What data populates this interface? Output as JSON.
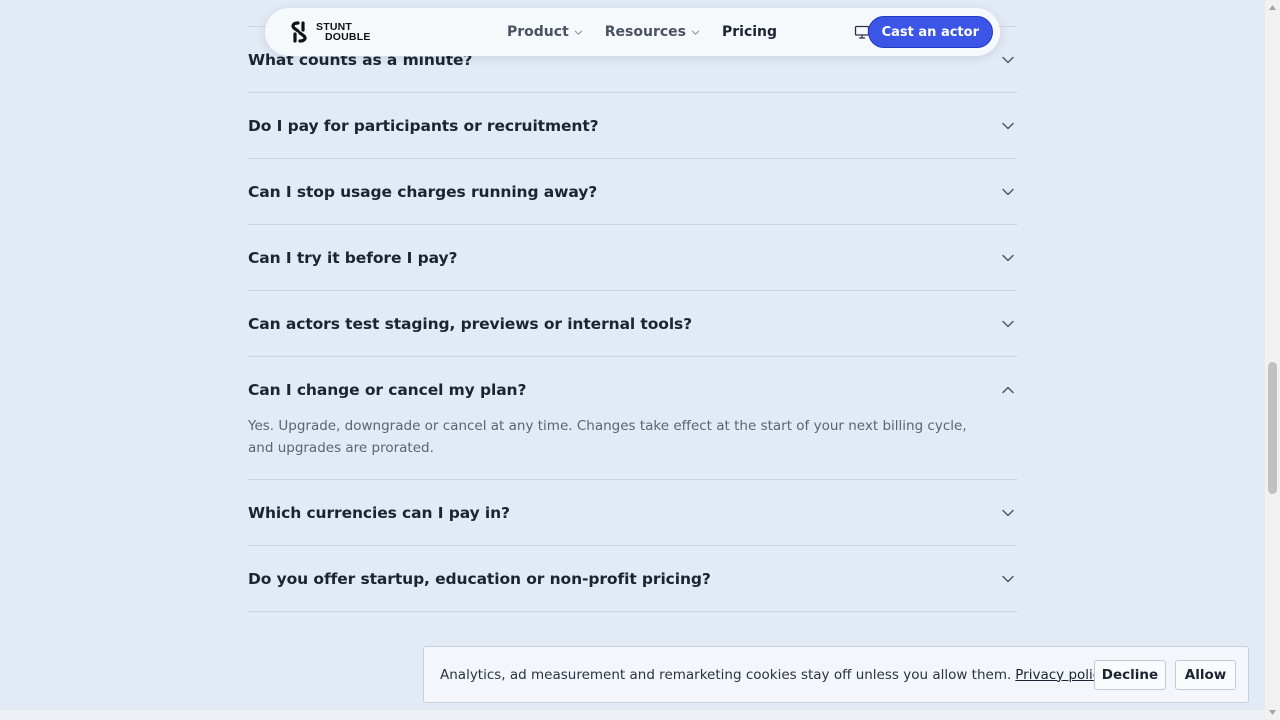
{
  "nav": {
    "logo_line1": "STUNT",
    "logo_line2": "DOUBLE",
    "links": [
      {
        "label": "Product",
        "has_dropdown": true
      },
      {
        "label": "Resources",
        "has_dropdown": true
      },
      {
        "label": "Pricing",
        "has_dropdown": false
      }
    ],
    "screen_icon": "monitor-icon",
    "cta_label": "Cast an actor"
  },
  "faq": {
    "items": [
      {
        "question": "What counts as a minute?",
        "expanded": false
      },
      {
        "question": "Do I pay for participants or recruitment?",
        "expanded": false
      },
      {
        "question": "Can I stop usage charges running away?",
        "expanded": false
      },
      {
        "question": "Can I try it before I pay?",
        "expanded": false
      },
      {
        "question": "Can actors test staging, previews or internal tools?",
        "expanded": false
      },
      {
        "question": "Can I change or cancel my plan?",
        "expanded": true,
        "answer": "Yes. Upgrade, downgrade or cancel at any time. Changes take effect at the start of your next billing cycle, and upgrades are prorated."
      },
      {
        "question": "Which currencies can I pay in?",
        "expanded": false
      },
      {
        "question": "Do you offer startup, education or non-profit pricing?",
        "expanded": false
      }
    ]
  },
  "cookie": {
    "text": "Analytics, ad measurement and remarketing cookies stay off unless you allow them.",
    "link": "Privacy policy",
    "decline": "Decline",
    "allow": "Allow"
  },
  "colors": {
    "background": "#e2eaf5",
    "accent": "#3b55e6",
    "divider": "#ccd4df"
  }
}
